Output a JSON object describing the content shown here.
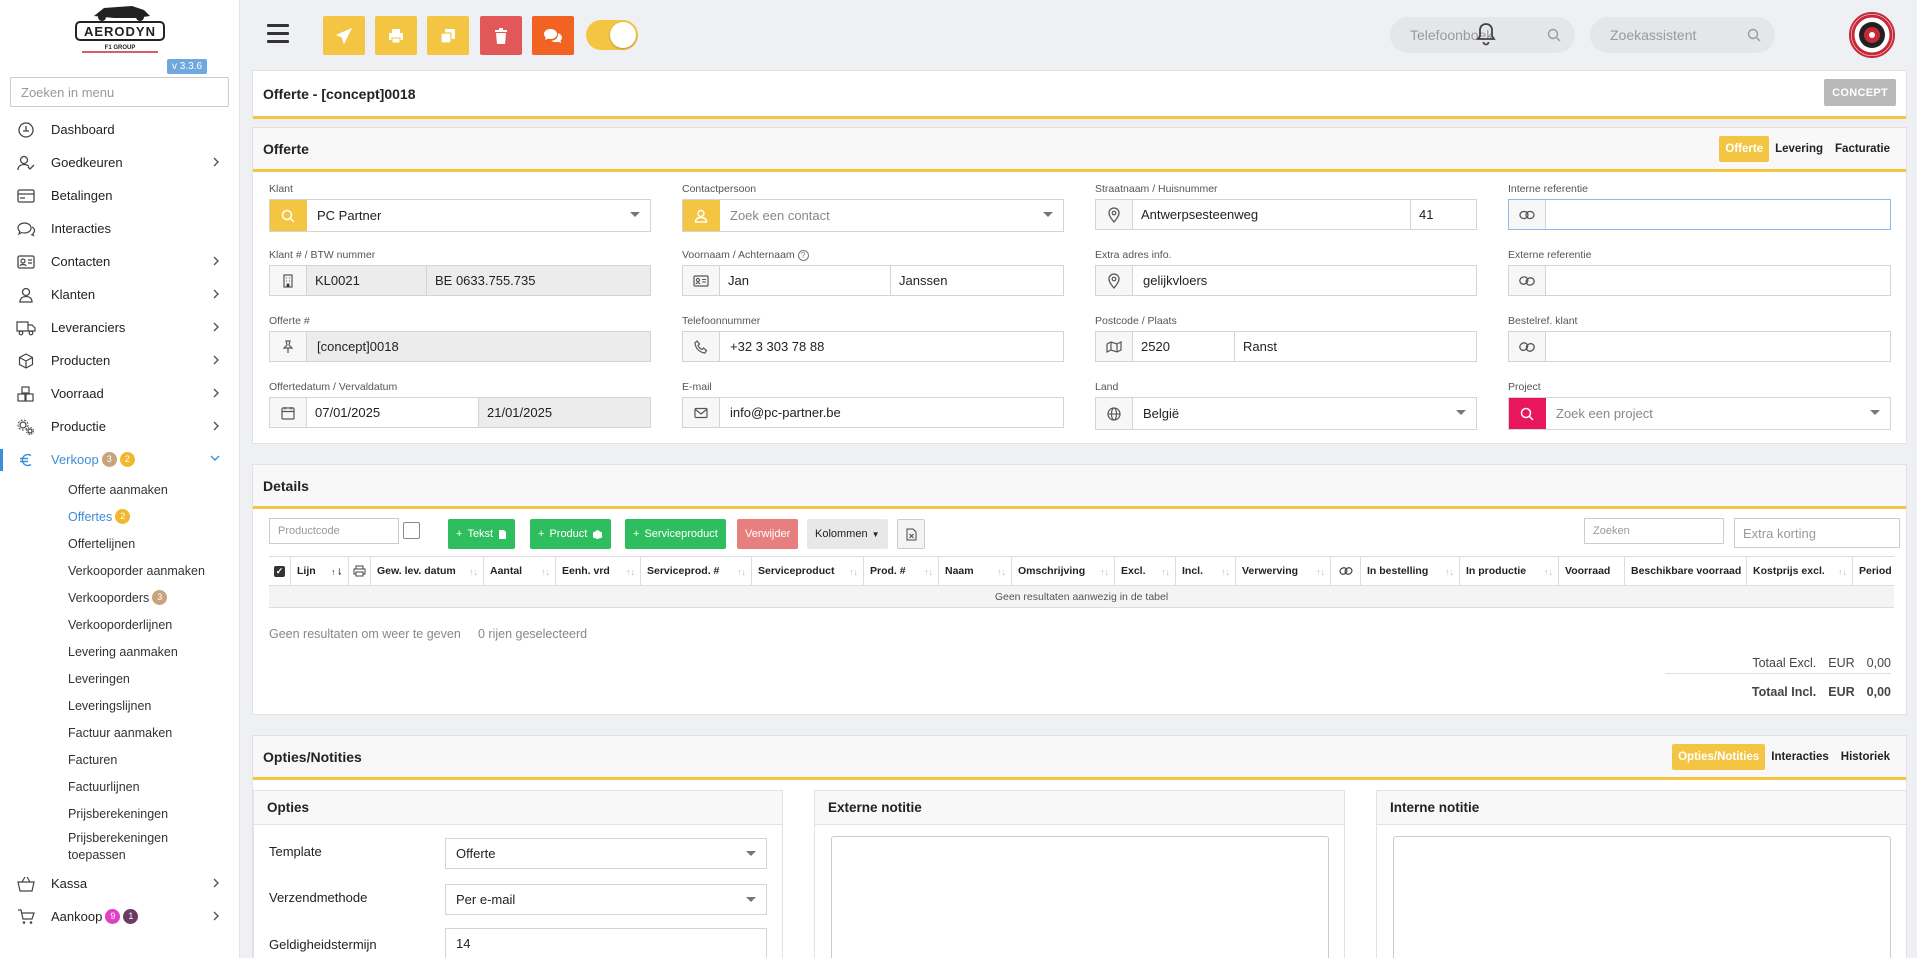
{
  "sidebar": {
    "version": "v 3.3.6",
    "search_placeholder": "Zoeken in menu",
    "items": [
      {
        "label": "Dashboard",
        "icon": "dashboard-icon",
        "chevron": false
      },
      {
        "label": "Goedkeuren",
        "icon": "user-check-icon",
        "chevron": true
      },
      {
        "label": "Betalingen",
        "icon": "card-icon",
        "chevron": false
      },
      {
        "label": "Interacties",
        "icon": "chat-icon",
        "chevron": false
      },
      {
        "label": "Contacten",
        "icon": "contact-card-icon",
        "chevron": true
      },
      {
        "label": "Klanten",
        "icon": "user-icon",
        "chevron": true
      },
      {
        "label": "Leveranciers",
        "icon": "truck-icon",
        "chevron": true
      },
      {
        "label": "Producten",
        "icon": "box-icon",
        "chevron": true
      },
      {
        "label": "Voorraad",
        "icon": "boxes-icon",
        "chevron": true
      },
      {
        "label": "Productie",
        "icon": "gears-icon",
        "chevron": true
      },
      {
        "label": "Verkoop",
        "icon": "euro-icon",
        "chevron": true,
        "badges": [
          "3",
          "2"
        ]
      }
    ],
    "sub_items": [
      {
        "label": "Offerte aanmaken"
      },
      {
        "label": "Offertes",
        "badge": "2",
        "active": true
      },
      {
        "label": "Offertelijnen"
      },
      {
        "label": "Verkooporder aanmaken"
      },
      {
        "label": "Verkooporders",
        "badge": "3"
      },
      {
        "label": "Verkooporderlijnen"
      },
      {
        "label": "Levering aanmaken"
      },
      {
        "label": "Leveringen"
      },
      {
        "label": "Leveringslijnen"
      },
      {
        "label": "Factuur aanmaken"
      },
      {
        "label": "Facturen"
      },
      {
        "label": "Factuurlijnen"
      },
      {
        "label": "Prijsberekeningen"
      },
      {
        "label": "Prijsberekeningen toepassen"
      }
    ],
    "bottom_items": [
      {
        "label": "Kassa",
        "icon": "basket-icon"
      },
      {
        "label": "Aankoop",
        "icon": "cart-icon",
        "badges": [
          "9",
          "1"
        ]
      }
    ]
  },
  "topbar": {
    "phonebook_placeholder": "Telefoonboek",
    "assistant_placeholder": "Zoekassistent"
  },
  "header": {
    "title": "Offerte - [concept]0018",
    "status": "CONCEPT"
  },
  "offerte": {
    "title": "Offerte",
    "tabs": [
      "Offerte",
      "Levering",
      "Facturatie"
    ],
    "fields": {
      "klant_label": "Klant",
      "klant_value": "PC Partner",
      "contact_label": "Contactpersoon",
      "contact_placeholder": "Zoek een contact",
      "straat_label": "Straatnaam / Huisnummer",
      "straat_value": "Antwerpsesteenweg",
      "huisnummer_value": "41",
      "interne_ref_label": "Interne referentie",
      "interne_ref_value": "",
      "klantnr_label": "Klant # / BTW nummer",
      "klantnr_value": "KL0021",
      "btw_value": "BE 0633.755.735",
      "naam_label": "Voornaam / Achternaam",
      "voornaam_value": "Jan",
      "achternaam_value": "Janssen",
      "extra_adres_label": "Extra adres info.",
      "extra_adres_value": "gelijkvloers",
      "externe_ref_label": "Externe referentie",
      "externe_ref_value": "",
      "offertenr_label": "Offerte #",
      "offertenr_value": "[concept]0018",
      "telefoon_label": "Telefoonnummer",
      "telefoon_value": "+32 3 303 78 88",
      "postcode_label": "Postcode / Plaats",
      "postcode_value": "2520",
      "plaats_value": "Ranst",
      "bestelref_label": "Bestelref. klant",
      "bestelref_value": "",
      "datum_label": "Offertedatum / Vervaldatum",
      "offertedatum_value": "07/01/2025",
      "vervaldatum_value": "21/01/2025",
      "email_label": "E-mail",
      "email_value": "info@pc-partner.be",
      "land_label": "Land",
      "land_value": "België",
      "project_label": "Project",
      "project_placeholder": "Zoek een project"
    }
  },
  "details": {
    "title": "Details",
    "productcode_placeholder": "Productcode",
    "btn_tekst": "Tekst",
    "btn_product": "Product",
    "btn_serviceproduct": "Serviceproduct",
    "btn_verwijder": "Verwijder",
    "btn_kolommen": "Kolommen",
    "search_placeholder": "Zoeken",
    "korting_placeholder": "Extra korting",
    "columns": [
      "Lijn",
      "Gew. lev. datum",
      "Aantal",
      "Eenh. vrd",
      "Serviceprod. #",
      "Serviceproduct",
      "Prod. #",
      "Naam",
      "Omschrijving",
      "Excl.",
      "Incl.",
      "Verwerving",
      "In bestelling",
      "In productie",
      "Voorraad",
      "Beschikbare voorraad",
      "Kostprijs excl.",
      "Period"
    ],
    "empty_text": "Geen resultaten aanwezig in de tabel",
    "info_text": "Geen resultaten om weer te geven",
    "selected_text": "0 rijen geselecteerd",
    "total_excl_label": "Totaal Excl.",
    "total_incl_label": "Totaal Incl.",
    "currency": "EUR",
    "total_excl_value": "0,00",
    "total_incl_value": "0,00"
  },
  "opties": {
    "title": "Opties/Notities",
    "tabs": [
      "Opties/Notities",
      "Interacties",
      "Historiek"
    ],
    "opties_title": "Opties",
    "template_label": "Template",
    "template_value": "Offerte",
    "verzend_label": "Verzendmethode",
    "verzend_value": "Per e-mail",
    "geldigheid_label": "Geldigheidstermijn",
    "geldigheid_value": "14",
    "externe_notitie_title": "Externe notitie",
    "interne_notitie_title": "Interne notitie"
  },
  "colors": {
    "accent_yellow": "#f4c542",
    "danger_red": "#e25858",
    "orange": "#f26222",
    "green": "#2fbe5f",
    "link_blue": "#3d8ed8",
    "pink": "#e8175d"
  }
}
